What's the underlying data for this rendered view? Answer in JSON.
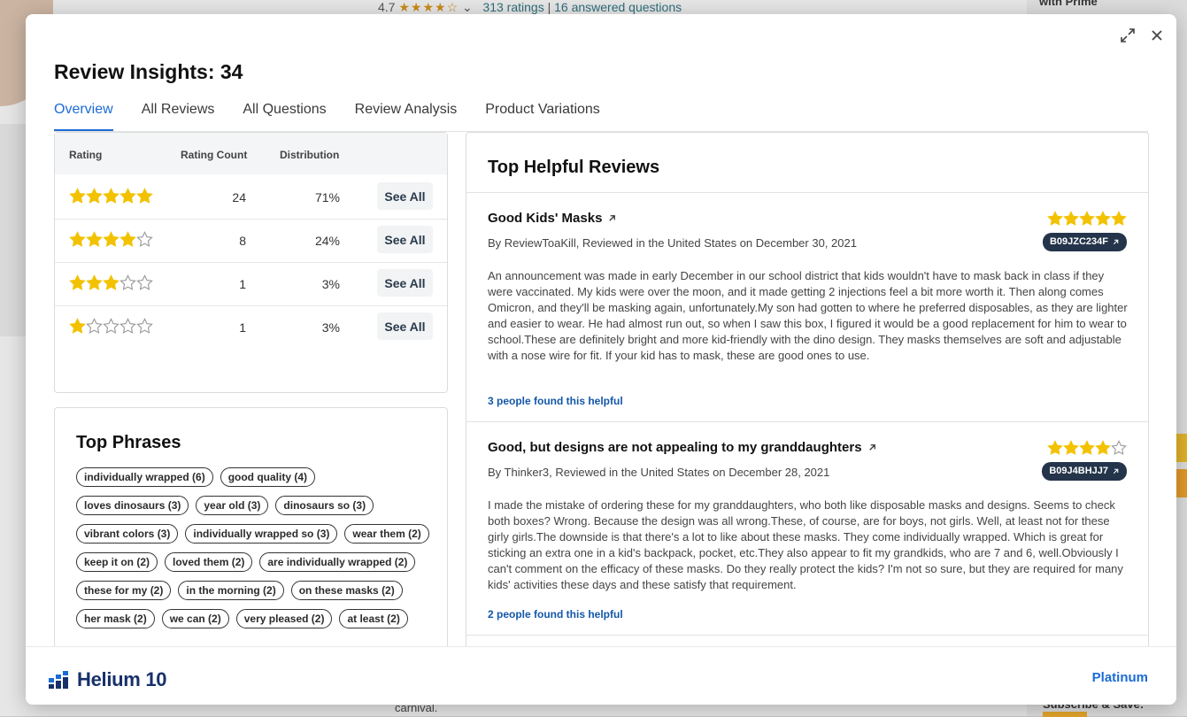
{
  "background": {
    "rating_value": "4.7",
    "ratings_link": "313 ratings",
    "separator": "|",
    "questions_link": "16 answered questions",
    "right_top": "with Prime",
    "bottom_text": "carnival.",
    "bottom_right": "Subscribe & Save:"
  },
  "modal": {
    "title": "Review Insights: 34",
    "tabs": [
      {
        "label": "Overview"
      },
      {
        "label": "All Reviews"
      },
      {
        "label": "All Questions"
      },
      {
        "label": "Review Analysis"
      },
      {
        "label": "Product Variations"
      }
    ],
    "active_tab": 0
  },
  "rating_table": {
    "headers": {
      "rating": "Rating",
      "count": "Rating Count",
      "distribution": "Distribution"
    },
    "see_all_label": "See All",
    "rows": [
      {
        "stars": 5,
        "count": "24",
        "distribution": "71%"
      },
      {
        "stars": 4,
        "count": "8",
        "distribution": "24%"
      },
      {
        "stars": 3,
        "count": "1",
        "distribution": "3%"
      },
      {
        "stars": 1,
        "count": "1",
        "distribution": "3%"
      }
    ]
  },
  "top_phrases": {
    "title": "Top Phrases",
    "chips": [
      "individually wrapped (6)",
      "good quality (4)",
      "loves dinosaurs (3)",
      "year old (3)",
      "dinosaurs so (3)",
      "vibrant colors (3)",
      "individually wrapped so (3)",
      "wear them (2)",
      "keep it on (2)",
      "loved them (2)",
      "are individually wrapped (2)",
      "these for my (2)",
      "in the morning (2)",
      "on these masks (2)",
      "her mask (2)",
      "we can (2)",
      "very pleased (2)",
      "at least (2)"
    ]
  },
  "top_reviews": {
    "title": "Top Helpful Reviews",
    "reviews": [
      {
        "title": "Good Kids' Masks",
        "byline": "By ReviewToaKill, Reviewed in the United States on December 30, 2021",
        "stars": 5,
        "asin": "B09JZC234F",
        "body": "An announcement was made in early December in our school district that kids wouldn't have to mask back in class if they were vaccinated. My kids were over the moon, and it made getting 2 injections feel a bit more worth it. Then along comes Omicron, and they'll be masking again, unfortunately.My son had gotten to where he preferred disposables, as they are lighter and easier to wear. He had almost run out, so when I saw this box, I figured it would be a good replacement for him to wear to school.These are definitely bright and more kid-friendly with the dino design. They masks themselves are soft and adjustable with a nose wire for fit. If your kid has to mask, these are good ones to use.",
        "helpful": "3 people found this helpful"
      },
      {
        "title": "Good, but designs are not appealing to my granddaughters",
        "byline": "By Thinker3, Reviewed in the United States on December 28, 2021",
        "stars": 4,
        "asin": "B09J4BHJJ7",
        "body": "I made the mistake of ordering these for my granddaughters, who both like disposable masks and designs. Seems to check both boxes? Wrong. Because the design was all wrong.These, of course, are for boys, not girls. Well, at least not for these girly girls.The downside is that there's a lot to like about these masks. They come individually wrapped. Which is great for sticking an extra one in a kid's backpack, pocket, etc.They also appear to fit my grandkids, who are 7 and 6, well.Obviously I can't comment on the efficacy of these masks. Do they really protect the kids? I'm not so sure, but they are required for many kids' activities these days and these satisfy that requirement.",
        "helpful": "2 people found this helpful"
      }
    ]
  },
  "footer": {
    "brand": "Helium 10",
    "plan": "Platinum"
  },
  "colors": {
    "accent": "#1a6bd6",
    "star_filled": "#f2c200",
    "star_empty": "#9a9a9a",
    "asin_badge": "#24344a",
    "brand": "#17306a"
  },
  "icons": [
    "expand-icon",
    "close-icon",
    "star-icon",
    "external-link-icon",
    "helium10-logo-icon"
  ]
}
